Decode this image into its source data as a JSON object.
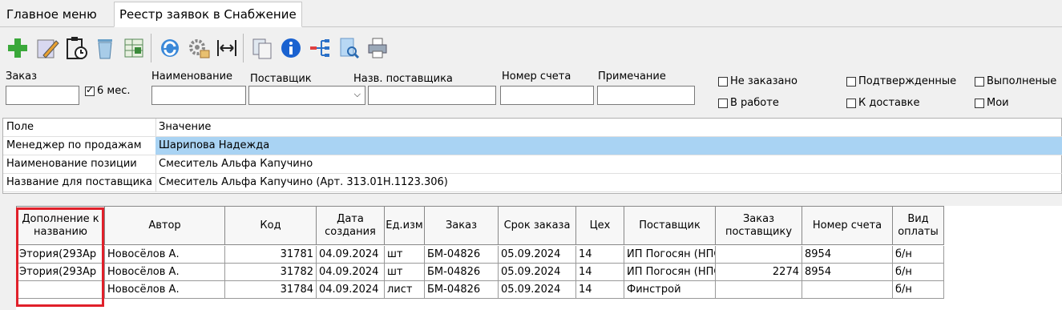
{
  "tabs": [
    {
      "label": "Главное меню"
    },
    {
      "label": "Реестр заявок в Снабжение"
    }
  ],
  "toolbar_icons": [
    "add-icon",
    "edit-icon",
    "clipboard-clock-icon",
    "trash-icon",
    "excel-icon",
    "refresh-icon",
    "settings-icon",
    "fit-width-icon",
    "copy-icon",
    "info-icon",
    "tree-icon",
    "preview-icon",
    "print-icon"
  ],
  "filters": {
    "order_label": "Заказ",
    "six_months_label": "6 мес.",
    "name_label": "Наименование",
    "supplier_label": "Поставщик",
    "supplier_name_label": "Назв. поставщика",
    "invoice_label": "Номер счета",
    "note_label": "Примечание",
    "not_ordered": "Не заказано",
    "confirmed": "Подтвержденные",
    "completed": "Выполненые",
    "in_work": "В работе",
    "to_delivery": "К доставке",
    "mine": "Мои"
  },
  "properties": {
    "col_field": "Поле",
    "col_value": "Значение",
    "rows": [
      {
        "field": "Менеджер по продажам",
        "value": "Шарипова Надежда"
      },
      {
        "field": "Наименование позиции",
        "value": "Смеситель Альфа Капучино"
      },
      {
        "field": "Название для поставщика",
        "value": "Смеситель Альфа Капучино (Арт. 313.01Н.1123.306)"
      }
    ]
  },
  "grid": {
    "headers": [
      "Дополнение к названию",
      "Автор",
      "Код",
      "Дата создания",
      "Ед.изм",
      "Заказ",
      "Срок заказа",
      "Цех",
      "Поставщик",
      "Заказ поставщику",
      "Номер счета",
      "Вид оплаты"
    ],
    "rows": [
      [
        "Этория(293Ар",
        "Новосёлов А.",
        "31781",
        "04.09.2024",
        "шт",
        "БМ-04826",
        "05.09.2024",
        "14",
        "ИП Погосян (НПС",
        "",
        "8954",
        "б/н"
      ],
      [
        "Этория(293Ар",
        "Новосёлов А.",
        "31782",
        "04.09.2024",
        "шт",
        "БМ-04826",
        "05.09.2024",
        "14",
        "ИП Погосян (НПС",
        "2274",
        "8954",
        "б/н"
      ],
      [
        "",
        "Новосёлов А.",
        "31784",
        "04.09.2024",
        "лист",
        "БМ-04826",
        "05.09.2024",
        "14",
        "Финстрой",
        "",
        "",
        "б/н"
      ]
    ]
  },
  "colors": {
    "selection": "#a9d3f3",
    "highlight": "#e0202a"
  }
}
